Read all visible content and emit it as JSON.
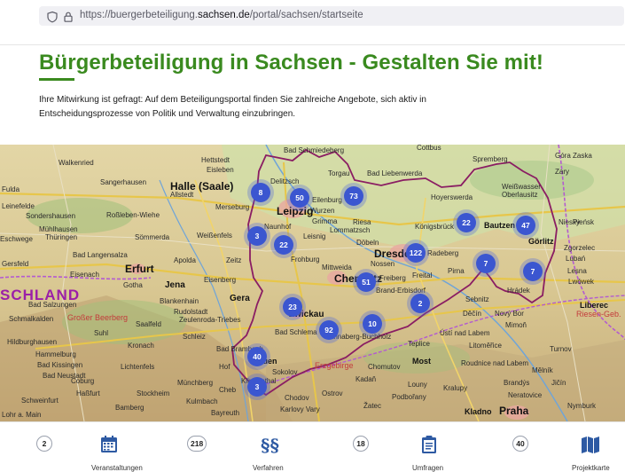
{
  "browser": {
    "url_prefix": "https://buergerbeteiligung.",
    "url_domain": "sachsen.de",
    "url_path": "/portal/sachsen/startseite"
  },
  "header": {
    "title": "Bürgerbeteiligung in Sachsen - Gestalten Sie mit!",
    "intro_line1": "Ihre Mitwirkung ist gefragt: Auf dem Beteiligungsportal finden Sie zahlreiche Angebote, sich aktiv in",
    "intro_line2": "Entscheidungsprozesse von Politik und Verwaltung einzubringen."
  },
  "map": {
    "clusters": [
      "8",
      "50",
      "73",
      "22",
      "47",
      "3",
      "22",
      "122",
      "7",
      "7",
      "51",
      "2",
      "23",
      "10",
      "92",
      "40",
      "3"
    ],
    "cities": [
      "Leipzig",
      "Dresden",
      "Chemnitz",
      "Zwickau",
      "Erfurt",
      "Jena",
      "Gera",
      "Praha",
      "Most",
      "Kladno",
      "Halle (Saale)",
      "SCHLAND",
      "Görlitz",
      "Bautzen",
      "Liberec",
      "Plauen"
    ],
    "places": [
      "Hettstedt",
      "Bad Schmiedeberg",
      "Cottbus",
      "Spremberg",
      "Zary",
      "Góra Zaska",
      "Walkenried",
      "Eisleben",
      "Torgau",
      "Bad Liebenwerda",
      "Delitzsch",
      "Weißwasser",
      "Oberlausitz",
      "Sangerhausen",
      "Allstedt",
      "Eilenburg",
      "Hoyerswerda",
      "Leinefelde",
      "Sondershausen",
      "Roßleben-Wiehe",
      "Merseburg",
      "Wurzen",
      "Riesa",
      "Niesky",
      "Mühlhausen",
      "Thüringen",
      "Naunhof",
      "Grimma",
      "Lommatzsch",
      "Königsbrück",
      "Pieńsk",
      "Eschwege",
      "Sömmerda",
      "Weißenfels",
      "Leisnig",
      "Döbeln",
      "Radeberg",
      "Zgorzelec",
      "Bad Langensalza",
      "Apolda",
      "Zeitz",
      "Frohburg",
      "Nossen",
      "Freital",
      "Lubań",
      "Lesna",
      "Eisenach",
      "Eisenberg",
      "Mittweida",
      "Pirna",
      "Lwówek",
      "Bad Salzungen",
      "Gotha",
      "Blankenhain",
      "Rudolstadt",
      "Freiberg",
      "Brand-Erbisdorf",
      "Sebnitz",
      "Hrádek",
      "Schmalkalden",
      "Großer Beerberg",
      "Suhl",
      "Saalfeld",
      "Zeulenroda-Triebes",
      "Annaberg-Buchholz",
      "Bad Schlema",
      "Děčín",
      "Nový Bor",
      "Mimoň",
      "Ústí nad Labem",
      "Litoměřice",
      "Teplice",
      "Louny",
      "Chomutov",
      "Kadaň",
      "Roudnice nad Labem",
      "Hildburghausen",
      "Schleiz",
      "Mělník",
      "Bad Brambach",
      "Sokolov",
      "Cheb",
      "Ostrov",
      "Podbořany",
      "Kralupy",
      "Kronach",
      "Hof",
      "Lichtenfels",
      "Münchberg",
      "Klingenthal",
      "Chodov",
      "Karlovy Vary",
      "Žatec",
      "Turnov",
      "Jičín",
      "Nymburk",
      "Neratovice",
      "Brandýs",
      "Bad Kissingen",
      "Coburg",
      "Stockheim",
      "Bad Neustadt",
      "Haßfurt",
      "Bamberg",
      "Kulmbach",
      "Bayreuth",
      "Schweinfurt",
      "Erzgebirge",
      "Riesen-Geb.",
      "Lohr a. Main",
      "Hammelburg",
      "Gersfeld",
      "Fulda"
    ]
  },
  "stats": [
    {
      "count": "2",
      "label": "Veranstaltungen",
      "icon": "calendar-icon"
    },
    {
      "count": "218",
      "label": "Verfahren",
      "icon": "paragraph-icon"
    },
    {
      "count": "18",
      "label": "Umfragen",
      "icon": "clipboard-icon"
    },
    {
      "count": "40",
      "label": "Projektkarte",
      "icon": "map-icon"
    }
  ]
}
